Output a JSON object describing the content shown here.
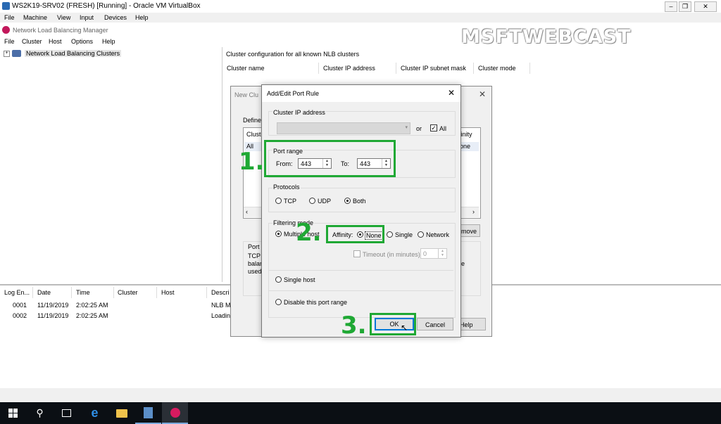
{
  "vbox": {
    "title": "WS2K19-SRV02 (FRESH) [Running] - Oracle VM VirtualBox",
    "menu": [
      "File",
      "Machine",
      "View",
      "Input",
      "Devices",
      "Help"
    ]
  },
  "nlb": {
    "title": "Network Load Balancing Manager",
    "menu": [
      "File",
      "Cluster",
      "Host",
      "Options",
      "Help"
    ],
    "tree_root": "Network Load Balancing Clusters",
    "right_header": "Cluster configuration for all known NLB clusters",
    "columns": [
      "Cluster name",
      "Cluster IP address",
      "Cluster IP subnet mask",
      "Cluster mode"
    ]
  },
  "log": {
    "columns": [
      "Log En...",
      "Date",
      "Time",
      "Cluster",
      "Host",
      "Descri"
    ],
    "rows": [
      {
        "id": "0001",
        "date": "11/19/2019",
        "time": "2:02:25 AM",
        "desc": "NLB M"
      },
      {
        "id": "0002",
        "date": "11/19/2019",
        "time": "2:02:25 AM",
        "desc": "Loadin"
      }
    ]
  },
  "bg_dialog": {
    "title": "New Clu",
    "defined": "Defined",
    "col_left": "Cluste",
    "col_right": "finity",
    "row_left": "All",
    "row_right": "one",
    "remove_btn": "move",
    "port_label": "Port r",
    "desc_lines": [
      "TCP",
      "balar",
      "used"
    ],
    "desc_right": "re",
    "help_btn": "Help"
  },
  "dialog": {
    "title": "Add/Edit Port Rule",
    "cluster_ip_label": "Cluster IP address",
    "or_label": "or",
    "all_label": "All",
    "all_checked": true,
    "port_range_label": "Port range",
    "from_label": "From:",
    "from_value": "443",
    "to_label": "To:",
    "to_value": "443",
    "protocols_label": "Protocols",
    "protocols": [
      "TCP",
      "UDP",
      "Both"
    ],
    "protocol_selected": "Both",
    "filtering_label": "Filtering mode",
    "multiple_host_label": "Multiple host",
    "affinity_label": "Affinity:",
    "affinity_options": [
      "None",
      "Single",
      "Network"
    ],
    "affinity_selected": "None",
    "timeout_label": "Timeout (in minutes):",
    "timeout_value": "0",
    "single_host_label": "Single host",
    "disable_label": "Disable this port range",
    "ok_label": "OK",
    "cancel_label": "Cancel"
  },
  "annotations": [
    "1.",
    "2.",
    "3."
  ],
  "watermark": "MSFTWEBCAST",
  "colors": {
    "annotation": "#1fa834",
    "taskbar": "#0b0f14"
  }
}
